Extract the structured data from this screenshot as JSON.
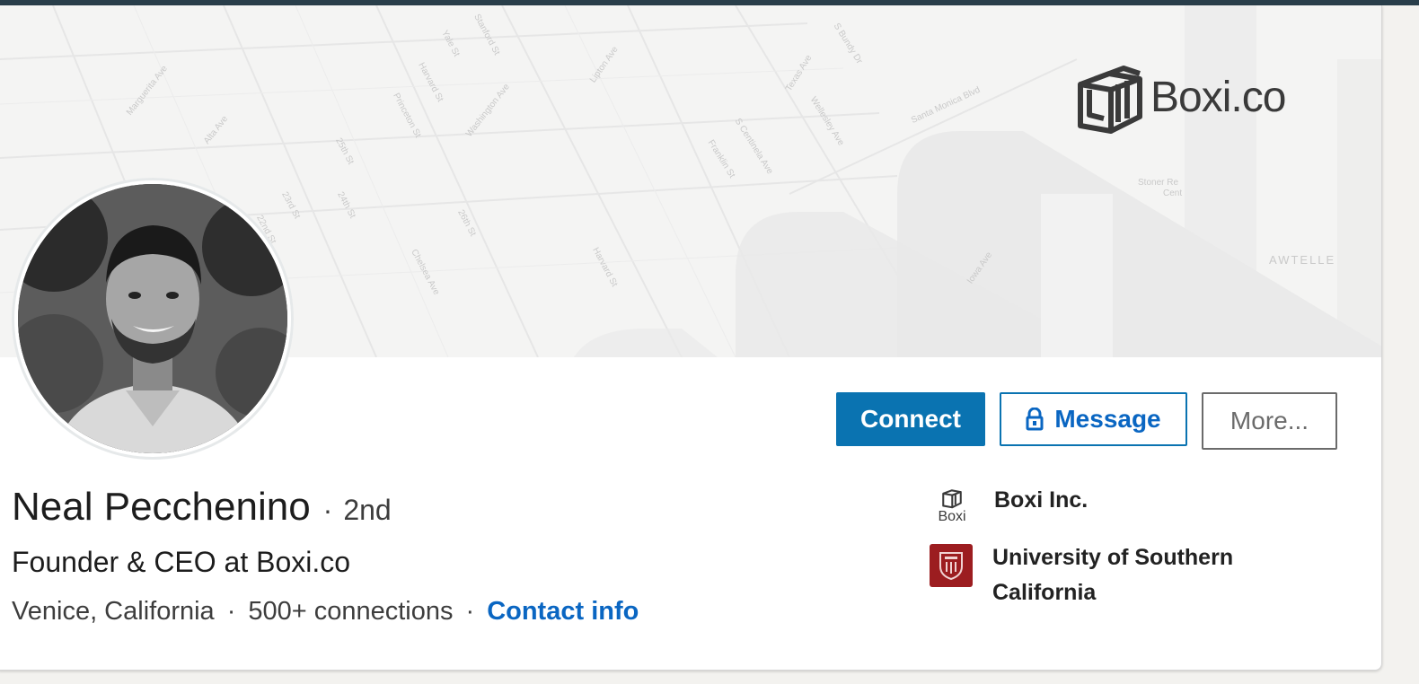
{
  "banner": {
    "brand_text": "Boxi.co",
    "map_labels": [
      "Marguerita Ave",
      "Alta Ave",
      "Harvard St",
      "Yale St",
      "Stanford St",
      "Princeton St",
      "Washington Ave",
      "25th St",
      "24th St",
      "23rd St",
      "22nd St",
      "26th St",
      "Chelsea Ave",
      "Harvard St",
      "Lipton Ave",
      "Franklin St",
      "S Centinela Ave",
      "Texas Ave",
      "Wellesley Ave",
      "S Bundy Dr",
      "Santa Monica Blvd",
      "Iowa Ave",
      "Stoner Re",
      "Cent",
      "AWTELLE"
    ]
  },
  "profile": {
    "name": "Neal Pecchenino",
    "degree": "2nd",
    "headline": "Founder & CEO at Boxi.co",
    "location": "Venice, California",
    "connections": "500+ connections",
    "contact_label": "Contact info"
  },
  "actions": {
    "connect_label": "Connect",
    "message_label": "Message",
    "more_label": "More..."
  },
  "organizations": [
    {
      "name": "Boxi Inc.",
      "logo_text": "Boxi",
      "icon": "boxi-logo-icon"
    },
    {
      "name": "University of Southern California",
      "icon": "usc-seal-icon"
    }
  ],
  "colors": {
    "primary_blue": "#0a73b1",
    "link_blue": "#0a66c2",
    "usc_red": "#9c1d20",
    "top_strip": "#293e4a"
  }
}
